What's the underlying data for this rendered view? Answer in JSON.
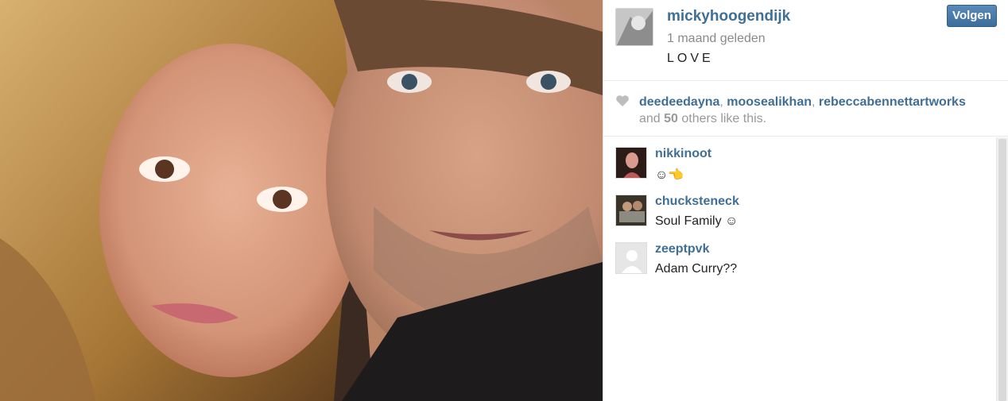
{
  "post": {
    "username": "mickyhoogendijk",
    "timestamp": "1 maand geleden",
    "caption": "LOVE",
    "follow_label": "Volgen"
  },
  "likes": {
    "icon": "heart-icon",
    "users": [
      "deedeedayna",
      "moosealikhan",
      "rebeccabennettartworks"
    ],
    "prefix": "and",
    "count": "50",
    "suffix": "others like this."
  },
  "comments": [
    {
      "user": "nikkinoot",
      "text": "☺👈"
    },
    {
      "user": "chucksteneck",
      "text": "Soul Family ☺"
    },
    {
      "user": "zeeptpvk",
      "text": "Adam Curry??"
    }
  ],
  "colors": {
    "link": "#3f6f96",
    "button": "#3d6d9b"
  }
}
